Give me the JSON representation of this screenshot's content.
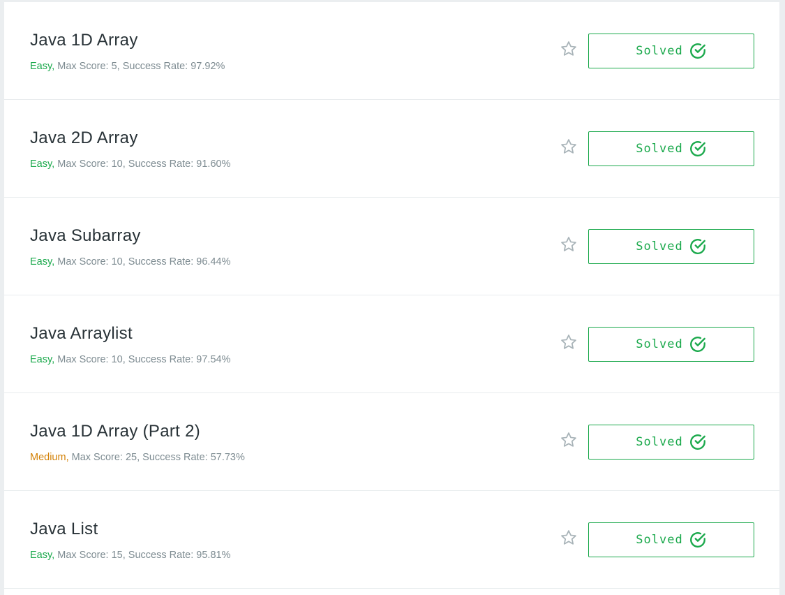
{
  "challenges": [
    {
      "title": "Java 1D Array",
      "difficulty": "Easy,",
      "difficulty_level": "easy",
      "details": "Max Score: 5, Success Rate: 97.92%",
      "button_label": "Solved"
    },
    {
      "title": "Java 2D Array",
      "difficulty": "Easy,",
      "difficulty_level": "easy",
      "details": "Max Score: 10, Success Rate: 91.60%",
      "button_label": "Solved"
    },
    {
      "title": "Java Subarray",
      "difficulty": "Easy,",
      "difficulty_level": "easy",
      "details": "Max Score: 10, Success Rate: 96.44%",
      "button_label": "Solved"
    },
    {
      "title": "Java Arraylist",
      "difficulty": "Easy,",
      "difficulty_level": "easy",
      "details": "Max Score: 10, Success Rate: 97.54%",
      "button_label": "Solved"
    },
    {
      "title": "Java 1D Array (Part 2)",
      "difficulty": "Medium,",
      "difficulty_level": "medium",
      "details": "Max Score: 25, Success Rate: 57.73%",
      "button_label": "Solved"
    },
    {
      "title": "Java List",
      "difficulty": "Easy,",
      "difficulty_level": "easy",
      "details": "Max Score: 15, Success Rate: 95.81%",
      "button_label": "Solved"
    }
  ],
  "icons": {
    "bookmark": "star-outline-icon",
    "solved": "circle-check-icon"
  },
  "colors": {
    "easy": "#1ba94c",
    "medium": "#d38106",
    "solved_accent": "#1ba94c",
    "meta_text": "#7d8b91",
    "title_text": "#283237"
  }
}
